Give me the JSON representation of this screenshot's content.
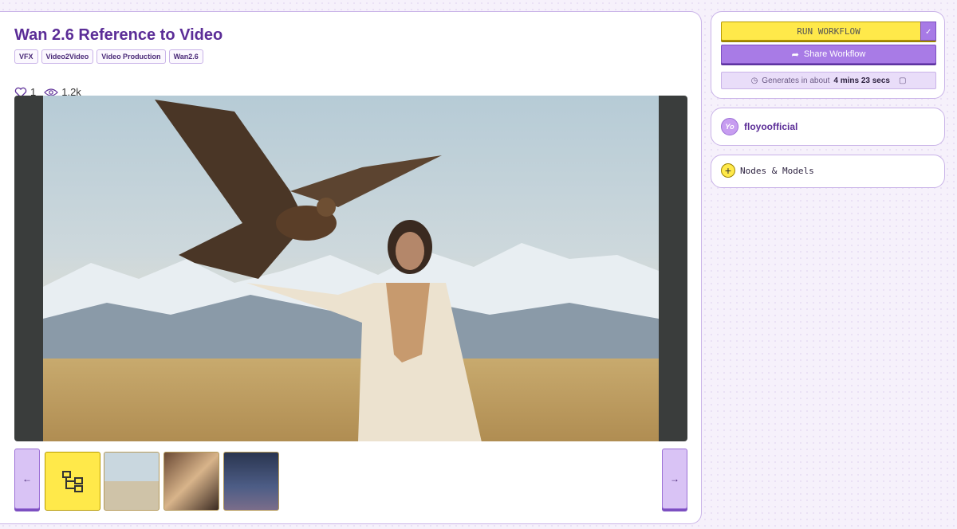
{
  "workflow": {
    "title": "Wan 2.6 Reference to Video",
    "tags": [
      "VFX",
      "Video2Video",
      "Video Production",
      "Wan2.6"
    ],
    "likes": "1",
    "views": "1.2k"
  },
  "gallery": {
    "prev_icon": "arrow-left-icon",
    "next_icon": "arrow-right-icon",
    "thumbnails": [
      "workflow-graph-icon",
      "eagle-woman-thumbnail",
      "man-speaking-thumbnail",
      "stage-performer-thumbnail"
    ]
  },
  "actions": {
    "run_label": "RUN WORKFLOW",
    "share_label": "Share Workflow",
    "generates_prefix": "Generates in about",
    "generates_time": "4 mins 23 secs"
  },
  "author": {
    "avatar_text": "Yo",
    "name": "floyoofficial"
  },
  "nodes": {
    "label": "Nodes & Models"
  },
  "colors": {
    "accent_purple": "#5b2d97",
    "run_yellow": "#ffe94a",
    "share_purple": "#a87be6"
  }
}
